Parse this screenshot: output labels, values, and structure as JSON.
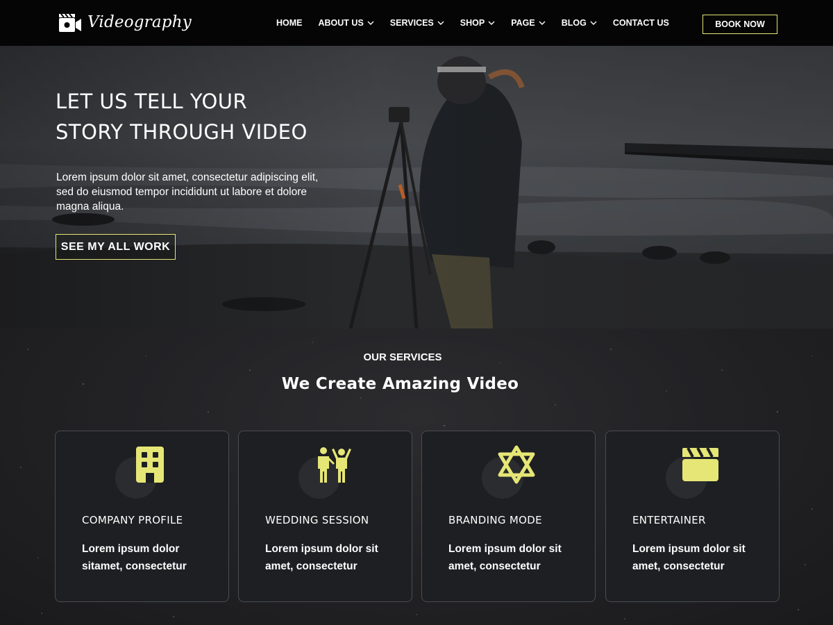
{
  "brand": {
    "name": "Videography",
    "accent": "#e6e676"
  },
  "nav": {
    "items": [
      {
        "label": "HOME",
        "dropdown": false
      },
      {
        "label": "ABOUT US",
        "dropdown": true
      },
      {
        "label": "SERVICES",
        "dropdown": true
      },
      {
        "label": "SHOP",
        "dropdown": true
      },
      {
        "label": "PAGE",
        "dropdown": true
      },
      {
        "label": "BLOG",
        "dropdown": true
      },
      {
        "label": "CONTACT US",
        "dropdown": false
      }
    ],
    "cta": "BOOK NOW"
  },
  "hero": {
    "title_line1": "LET US TELL YOUR",
    "title_line2": "STORY THROUGH VIDEO",
    "description": "Lorem ipsum dolor sit amet, consectetur adipiscing elit, sed do eiusmod tempor incididunt ut labore et dolore magna aliqua.",
    "button": "SEE MY ALL WORK"
  },
  "services": {
    "kicker": "OUR SERVICES",
    "title": "We Create Amazing Video",
    "cards": [
      {
        "icon": "building-icon",
        "title": "COMPANY PROFILE",
        "description": "Lorem ipsum dolor sitamet, consectetur"
      },
      {
        "icon": "people-icon",
        "title": "WEDDING SESSION",
        "description": "Lorem ipsum dolor sit amet, consectetur"
      },
      {
        "icon": "star-of-david-icon",
        "title": "BRANDING MODE",
        "description": "Lorem ipsum dolor sit amet, consectetur"
      },
      {
        "icon": "clapperboard-icon",
        "title": "ENTERTAINER",
        "description": "Lorem ipsum dolor sit amet, consectetur"
      }
    ]
  }
}
